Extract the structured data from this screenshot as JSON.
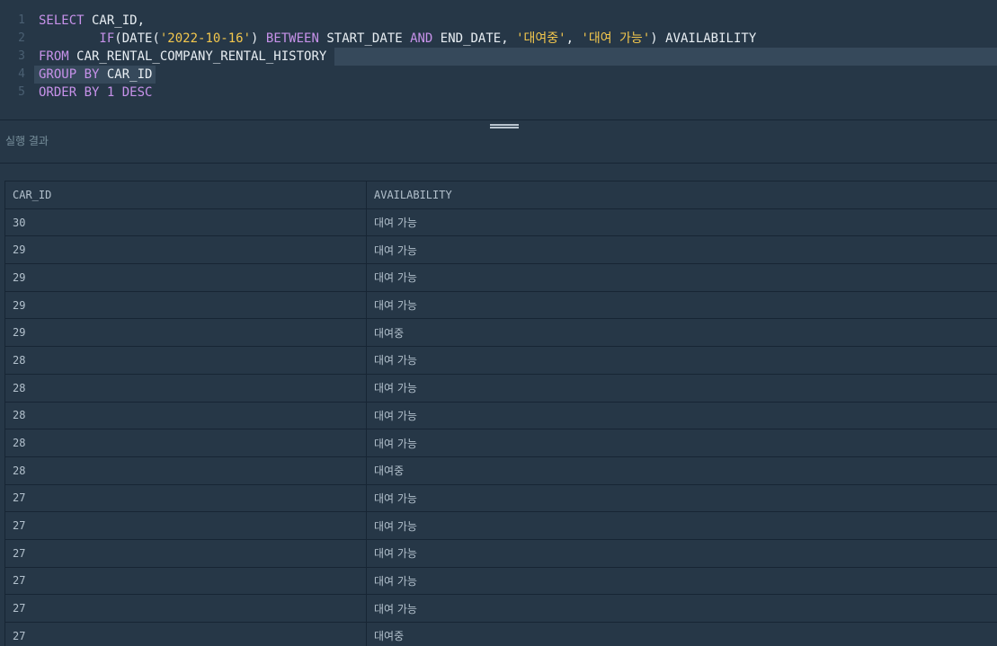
{
  "editor": {
    "lines": [
      {
        "num": "1",
        "tokens": [
          {
            "t": "SELECT",
            "c": "kw"
          },
          {
            "t": " CAR_ID,",
            "c": "pl"
          }
        ]
      },
      {
        "num": "2",
        "tokens": [
          {
            "t": "        IF",
            "c": "kw"
          },
          {
            "t": "(DATE(",
            "c": "pl"
          },
          {
            "t": "'2022-10-16'",
            "c": "str"
          },
          {
            "t": ") ",
            "c": "pl"
          },
          {
            "t": "BETWEEN",
            "c": "kw"
          },
          {
            "t": " START_DATE ",
            "c": "pl"
          },
          {
            "t": "AND",
            "c": "kw"
          },
          {
            "t": " END_DATE, ",
            "c": "pl"
          },
          {
            "t": "'대여중'",
            "c": "str"
          },
          {
            "t": ", ",
            "c": "pl"
          },
          {
            "t": "'대여 가능'",
            "c": "str"
          },
          {
            "t": ") AVAILABILITY",
            "c": "pl"
          }
        ]
      },
      {
        "num": "3",
        "tokens": [
          {
            "t": "FROM",
            "c": "kw"
          },
          {
            "t": " CAR_RENTAL_COMPANY_RENTAL_HISTORY",
            "c": "pl"
          }
        ]
      },
      {
        "num": "4",
        "tokens": [
          {
            "t": "GROUP BY",
            "c": "kw"
          },
          {
            "t": " CAR_ID",
            "c": "pl"
          }
        ]
      },
      {
        "num": "5",
        "tokens": [
          {
            "t": "ORDER BY",
            "c": "kw"
          },
          {
            "t": " 1",
            "c": "num"
          },
          {
            "t": " DESC",
            "c": "kw"
          }
        ]
      }
    ]
  },
  "result": {
    "title": "실행 결과",
    "columns": [
      "CAR_ID",
      "AVAILABILITY"
    ],
    "rows": [
      [
        "30",
        "대여 가능"
      ],
      [
        "29",
        "대여 가능"
      ],
      [
        "29",
        "대여 가능"
      ],
      [
        "29",
        "대여 가능"
      ],
      [
        "29",
        "대여중"
      ],
      [
        "28",
        "대여 가능"
      ],
      [
        "28",
        "대여 가능"
      ],
      [
        "28",
        "대여 가능"
      ],
      [
        "28",
        "대여 가능"
      ],
      [
        "28",
        "대여중"
      ],
      [
        "27",
        "대여 가능"
      ],
      [
        "27",
        "대여 가능"
      ],
      [
        "27",
        "대여 가능"
      ],
      [
        "27",
        "대여 가능"
      ],
      [
        "27",
        "대여 가능"
      ],
      [
        "27",
        "대여중"
      ]
    ]
  }
}
